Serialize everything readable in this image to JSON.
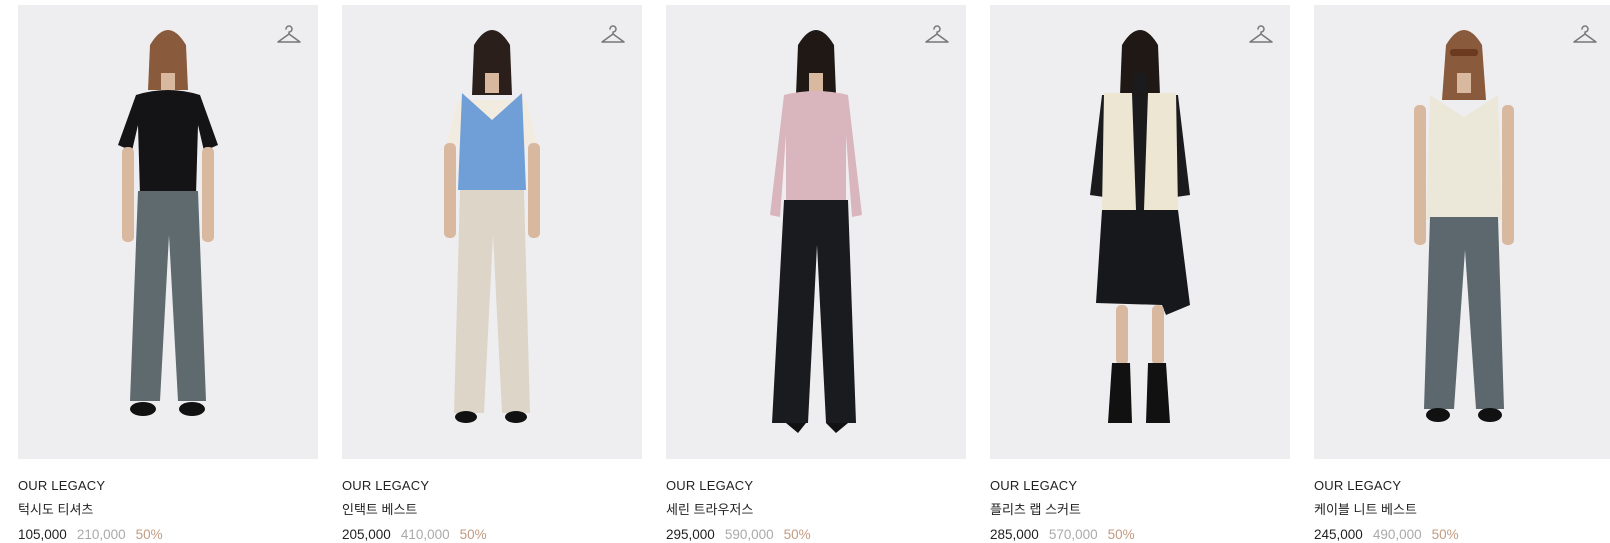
{
  "products": [
    {
      "brand": "OUR LEGACY",
      "name": "턱시도 티셔츠",
      "price": "105,000",
      "original_price": "210,000",
      "discount": "50%",
      "icon": "hanger-icon",
      "colors": {
        "top": "#141416",
        "bottom": "#5e6a6e",
        "shoes": "#111111"
      }
    },
    {
      "brand": "OUR LEGACY",
      "name": "인택트 베스트",
      "price": "205,000",
      "original_price": "410,000",
      "discount": "50%",
      "icon": "hanger-icon",
      "colors": {
        "top": "#6f9fd6",
        "bottom": "#ddd6c8",
        "shoes": "#111111"
      }
    },
    {
      "brand": "OUR LEGACY",
      "name": "세린 트라우저스",
      "price": "295,000",
      "original_price": "590,000",
      "discount": "50%",
      "icon": "hanger-icon",
      "colors": {
        "top": "#d9b5bd",
        "bottom": "#1a1b1e",
        "shoes": "#111111"
      }
    },
    {
      "brand": "OUR LEGACY",
      "name": "플리츠 랩 스커트",
      "price": "285,000",
      "original_price": "570,000",
      "discount": "50%",
      "icon": "hanger-icon",
      "colors": {
        "top": "#ece6d2",
        "bottom": "#17181b",
        "shoes": "#111111"
      }
    },
    {
      "brand": "OUR LEGACY",
      "name": "케이블 니트 베스트",
      "price": "245,000",
      "original_price": "490,000",
      "discount": "50%",
      "icon": "hanger-icon",
      "colors": {
        "top": "#ebe8da",
        "bottom": "#5c686d",
        "shoes": "#111111"
      }
    }
  ]
}
